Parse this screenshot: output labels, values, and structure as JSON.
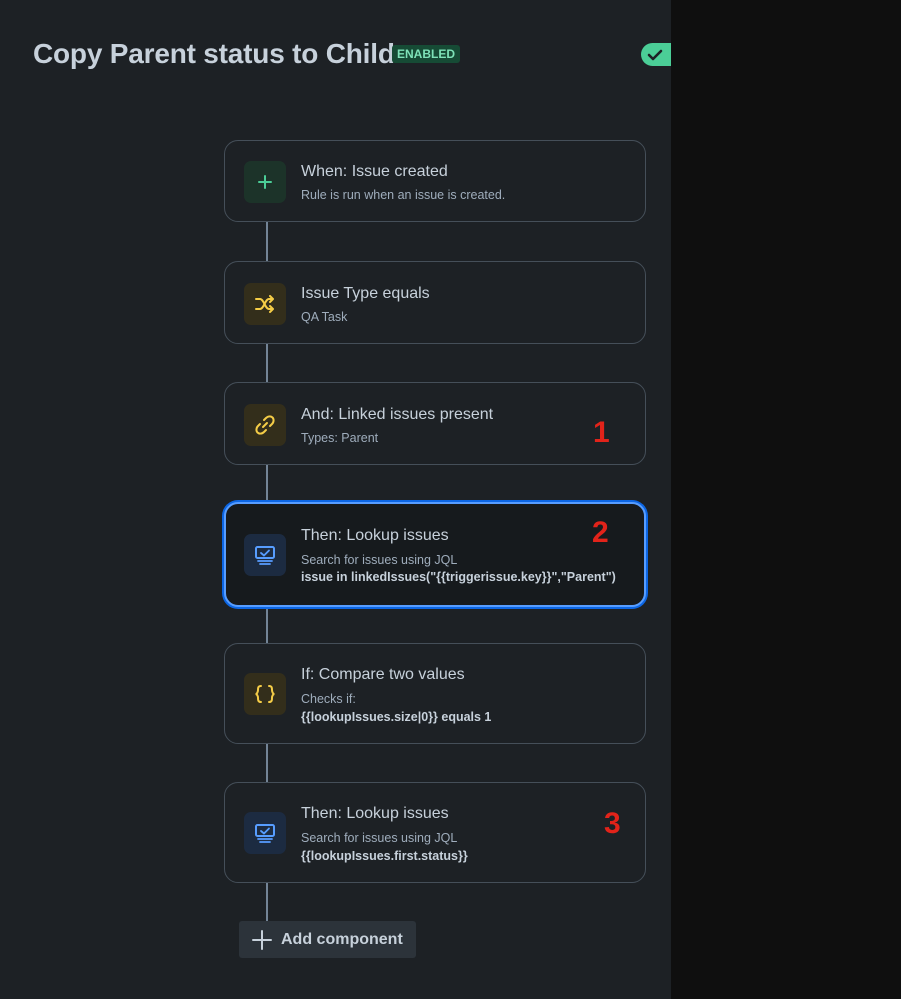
{
  "header": {
    "title": "Copy Parent status to Child",
    "status_badge": "ENABLED"
  },
  "rule_components": [
    {
      "title": "When: Issue created",
      "subtitle": "Rule is run when an issue is created.",
      "icon": "plus-icon"
    },
    {
      "title": "Issue Type equals",
      "subtitle": "QA Task",
      "icon": "shuffle-icon"
    },
    {
      "title": "And: Linked issues present",
      "subtitle": "Types: Parent",
      "icon": "link-icon"
    },
    {
      "title": "Then: Lookup issues",
      "subtitle": "Search for issues using JQL",
      "detail": "issue in linkedIssues(\"{{triggerissue.key}}\",\"Parent\")",
      "icon": "lookup-icon"
    },
    {
      "title": "If: Compare two values",
      "subtitle": "Checks if:",
      "detail": "{{lookupIssues.size|0}} equals 1",
      "icon": "braces-icon"
    },
    {
      "title": "Then: Lookup issues",
      "subtitle": "Search for issues using JQL",
      "detail": "{{lookupIssues.first.status}}",
      "icon": "lookup-icon"
    }
  ],
  "annotations": [
    "1",
    "2",
    "3"
  ],
  "add_component_label": "Add component",
  "colors": {
    "background": "#1d2125",
    "accent_selected": "#579dff",
    "enabled_badge": "#164b35",
    "annotation": "#e2231a"
  }
}
